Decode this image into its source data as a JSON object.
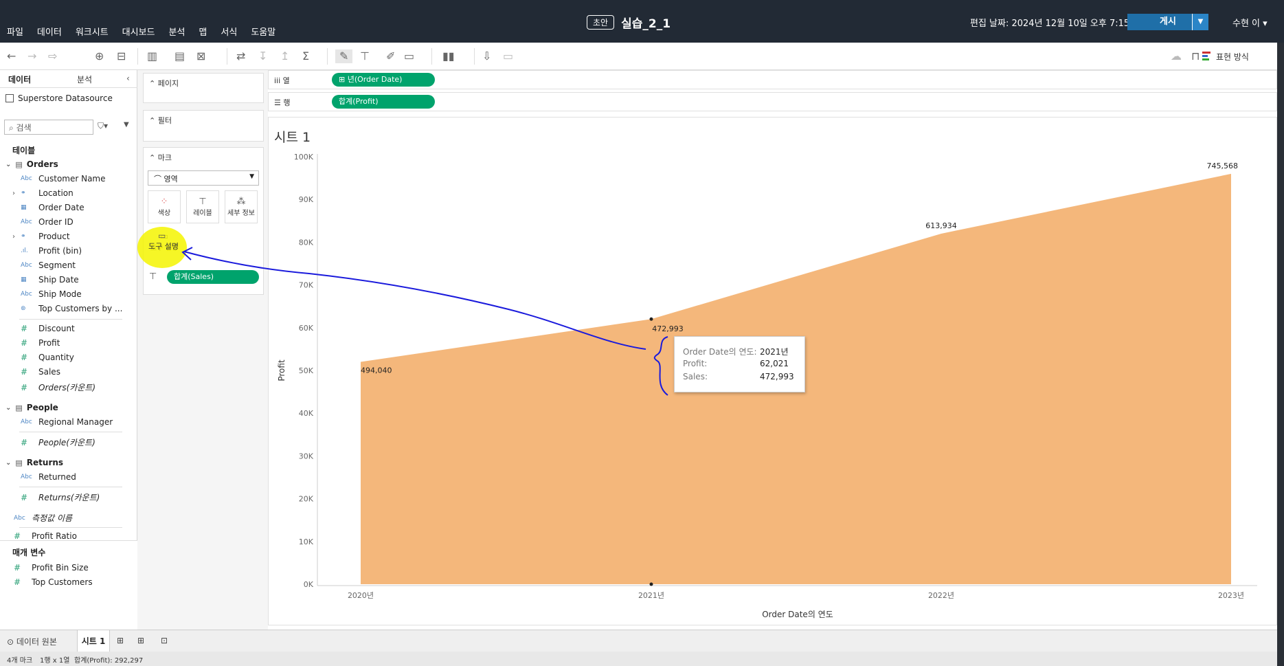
{
  "app": {
    "menu": [
      "파일",
      "데이터",
      "워크시트",
      "대시보드",
      "분석",
      "맵",
      "서식",
      "도움말"
    ],
    "draft_badge": "초안",
    "workbook_name": "실습_2_1",
    "edit_date": "편집 날짜: 2024년 12월 10일 오후 7:15",
    "publish_label": "게시",
    "user_label": "수현 이 ▾",
    "show_me_label": "표현 방식"
  },
  "left_pane": {
    "tab_data": "데이터",
    "tab_analytics": "분석",
    "datasource": "Superstore Datasource",
    "search_placeholder": "검색",
    "tables_heading": "테이블",
    "orders": {
      "name": "Orders",
      "dimensions": [
        "Customer Name",
        "Location",
        "Order Date",
        "Order ID",
        "Product",
        "Profit (bin)",
        "Segment",
        "Ship Date",
        "Ship Mode",
        "Top Customers by ..."
      ],
      "measures": [
        "Discount",
        "Profit",
        "Quantity",
        "Sales",
        "Orders(카운트)"
      ]
    },
    "people": {
      "name": "People",
      "dimensions": [
        "Regional Manager"
      ],
      "measures": [
        "People(카운트)"
      ]
    },
    "returns": {
      "name": "Returns",
      "dimensions": [
        "Returned"
      ],
      "measures": [
        "Returns(카운트)"
      ]
    },
    "measure_names": "측정값 이름",
    "profit_ratio": "Profit Ratio",
    "params_heading": "매개 변수",
    "params": [
      "Profit Bin Size",
      "Top Customers"
    ]
  },
  "shelves": {
    "pages": "페이지",
    "filters": "필터",
    "marks": "마크",
    "mark_type": "영역",
    "btn_color": "색상",
    "btn_label": "레이블",
    "btn_detail": "세부 정보",
    "btn_tooltip": "도구 설명",
    "label_pill": "합계(Sales)"
  },
  "columns_shelf": {
    "label": "열",
    "pill": "년(Order Date)"
  },
  "rows_shelf": {
    "label": "행",
    "pill": "합계(Profit)"
  },
  "sheet": {
    "title": "시트 1"
  },
  "chart_data": {
    "type": "area",
    "x": [
      "2020년",
      "2021년",
      "2022년",
      "2023년"
    ],
    "y_values": [
      52000,
      62021,
      82000,
      96000
    ],
    "data_labels": [
      "494,040",
      "472,993",
      "613,934",
      "745,568"
    ],
    "xlabel": "Order Date의 연도",
    "ylabel": "Profit",
    "ylim": [
      0,
      100000
    ],
    "yticks": [
      "0K",
      "10K",
      "20K",
      "30K",
      "40K",
      "50K",
      "60K",
      "70K",
      "80K",
      "90K",
      "100K"
    ],
    "fill_color": "#f4b77b",
    "grid": false
  },
  "tooltip": {
    "rows": [
      {
        "k": "Order Date의 연도:",
        "v": "2021년"
      },
      {
        "k": "Profit:",
        "v": "62,021"
      },
      {
        "k": "Sales:",
        "v": "472,993"
      }
    ]
  },
  "bottom": {
    "datasource_tab": "데이터 원본",
    "sheet_tab": "시트 1",
    "status_marks": "4개 마크",
    "status_grid": "1행 x 1열",
    "status_sum": "합계(Profit): 292,297"
  },
  "colors": {
    "pill_green": "#00a36c",
    "area_orange": "#f4b77b",
    "annotation_blue": "#1a1adc",
    "highlight_yellow": "#f5f500"
  }
}
